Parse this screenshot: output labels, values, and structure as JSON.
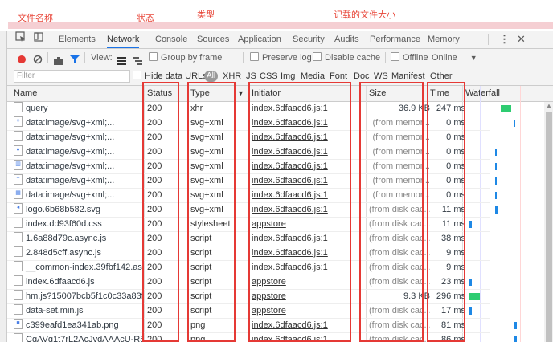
{
  "annotations": {
    "filename": "文件名称",
    "status": "状态",
    "type": "类型",
    "size": "记载的文件大小"
  },
  "tabs": [
    "Elements",
    "Network",
    "Console",
    "Sources",
    "Application",
    "Security",
    "Audits",
    "Performance",
    "Memory"
  ],
  "active_tab": "Network",
  "toolbar": {
    "view_label": "View:",
    "group_by_frame": "Group by frame",
    "preserve_log": "Preserve log",
    "disable_cache": "Disable cache",
    "offline": "Offline",
    "online": "Online"
  },
  "filter": {
    "placeholder": "Filter",
    "hide_data_urls": "Hide data URLs",
    "all": "All",
    "types": [
      "XHR",
      "JS",
      "CSS",
      "Img",
      "Media",
      "Font",
      "Doc",
      "WS",
      "Manifest",
      "Other"
    ]
  },
  "columns": {
    "name": "Name",
    "status": "Status",
    "type": "Type",
    "initiator": "Initiator",
    "size": "Size",
    "time": "Time",
    "waterfall": "Waterfall"
  },
  "rows": [
    {
      "name": "query",
      "status": "200",
      "type": "xhr",
      "initiator": "index.6dfaacd6.js:1",
      "size": "36.9 KB",
      "time": "247 ms",
      "icon": "file",
      "wf_start": 0.42,
      "wf_len": 0.14,
      "wf_color": "#2ecc71"
    },
    {
      "name": "data:image/svg+xml;...",
      "status": "200",
      "type": "svg+xml",
      "initiator": "index.6dfaacd6.js:1",
      "size": "(from memor...",
      "time": "0 ms",
      "icon": "circle",
      "wf_start": 0.6,
      "wf_len": 0.02,
      "wf_color": "#1e88e5"
    },
    {
      "name": "data:image/svg+xml;...",
      "status": "200",
      "type": "svg+xml",
      "initiator": "index.6dfaacd6.js:1",
      "size": "(from memor...",
      "time": "0 ms",
      "icon": "file",
      "wf_start": 0.0,
      "wf_len": 0.0,
      "wf_color": "#1e88e5"
    },
    {
      "name": "data:image/svg+xml;...",
      "status": "200",
      "type": "svg+xml",
      "initiator": "index.6dfaacd6.js:1",
      "size": "(from memor...",
      "time": "0 ms",
      "icon": "blue",
      "wf_start": 0.35,
      "wf_len": 0.02,
      "wf_color": "#1e88e5"
    },
    {
      "name": "data:image/svg+xml;...",
      "status": "200",
      "type": "svg+xml",
      "initiator": "index.6dfaacd6.js:1",
      "size": "(from memor...",
      "time": "0 ms",
      "icon": "chart",
      "wf_start": 0.35,
      "wf_len": 0.02,
      "wf_color": "#1e88e5"
    },
    {
      "name": "data:image/svg+xml;...",
      "status": "200",
      "type": "svg+xml",
      "initiator": "index.6dfaacd6.js:1",
      "size": "(from memor...",
      "time": "0 ms",
      "icon": "plus",
      "wf_start": 0.35,
      "wf_len": 0.02,
      "wf_color": "#1e88e5"
    },
    {
      "name": "data:image/svg+xml;...",
      "status": "200",
      "type": "svg+xml",
      "initiator": "index.6dfaacd6.js:1",
      "size": "(from memor...",
      "time": "0 ms",
      "icon": "grid",
      "wf_start": 0.35,
      "wf_len": 0.02,
      "wf_color": "#1e88e5"
    },
    {
      "name": "logo.6b68b582.svg",
      "status": "200",
      "type": "svg+xml",
      "initiator": "index.6dfaacd6.js:1",
      "size": "(from disk cac...",
      "time": "11 ms",
      "icon": "logo",
      "wf_start": 0.35,
      "wf_len": 0.03,
      "wf_color": "#1e88e5"
    },
    {
      "name": "index.dd93f60d.css",
      "status": "200",
      "type": "stylesheet",
      "initiator": "appstore",
      "size": "(from disk cac...",
      "time": "11 ms",
      "icon": "file",
      "wf_start": 0.0,
      "wf_len": 0.03,
      "wf_color": "#1e88e5"
    },
    {
      "name": "1.6a88d79c.async.js",
      "status": "200",
      "type": "script",
      "initiator": "index.6dfaacd6.js:1",
      "size": "(from disk cac...",
      "time": "38 ms",
      "icon": "file",
      "wf_start": 0.0,
      "wf_len": 0.0,
      "wf_color": "#1e88e5"
    },
    {
      "name": "2.848d5cff.async.js",
      "status": "200",
      "type": "script",
      "initiator": "index.6dfaacd6.js:1",
      "size": "(from disk cac...",
      "time": "9 ms",
      "icon": "file",
      "wf_start": 0.0,
      "wf_len": 0.0,
      "wf_color": "#1e88e5"
    },
    {
      "name": "__common-index.39fbf142.as...",
      "status": "200",
      "type": "script",
      "initiator": "index.6dfaacd6.js:1",
      "size": "(from disk cac...",
      "time": "9 ms",
      "icon": "file",
      "wf_start": 0.0,
      "wf_len": 0.0,
      "wf_color": "#1e88e5"
    },
    {
      "name": "index.6dfaacd6.js",
      "status": "200",
      "type": "script",
      "initiator": "appstore",
      "size": "(from disk cac...",
      "time": "23 ms",
      "icon": "file",
      "wf_start": 0.0,
      "wf_len": 0.03,
      "wf_color": "#1e88e5"
    },
    {
      "name": "hm.js?15007bcb5f1c0c33a83f...",
      "status": "200",
      "type": "script",
      "initiator": "appstore",
      "size": "9.3 KB",
      "time": "296 ms",
      "icon": "file",
      "wf_start": 0.0,
      "wf_len": 0.14,
      "wf_color": "#2ecc71"
    },
    {
      "name": "data-set.min.js",
      "status": "200",
      "type": "script",
      "initiator": "appstore",
      "size": "(from disk cac...",
      "time": "17 ms",
      "icon": "file",
      "wf_start": 0.0,
      "wf_len": 0.03,
      "wf_color": "#1e88e5"
    },
    {
      "name": "c399eafd1ea341ab.png",
      "status": "200",
      "type": "png",
      "initiator": "index.6dfaacd6.js:1",
      "size": "(from disk cac...",
      "time": "81 ms",
      "icon": "img",
      "wf_start": 0.6,
      "wf_len": 0.04,
      "wf_color": "#1e88e5"
    },
    {
      "name": "CgAVg1t7rL2AcJvdAAAcU-R5...",
      "status": "200",
      "type": "png",
      "initiator": "index.6dfaacd6.js:1",
      "size": "(from disk cac...",
      "time": "86 ms",
      "icon": "file",
      "wf_start": 0.6,
      "wf_len": 0.04,
      "wf_color": "#1e88e5"
    }
  ],
  "colors": {
    "accent": "#1a73e8",
    "record": "#e53935",
    "highlight_box": "#e53935",
    "annotation": "#e8473a"
  }
}
